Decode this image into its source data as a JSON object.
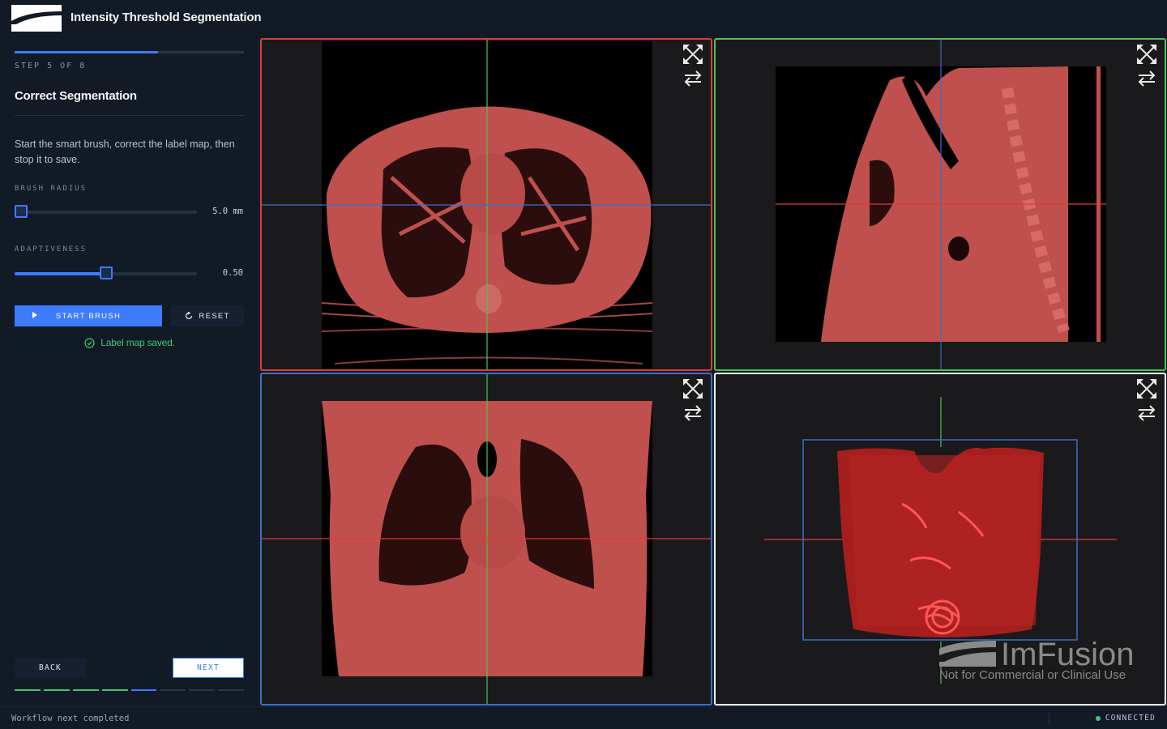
{
  "header": {
    "title": "Intensity Threshold Segmentation",
    "logo": "imfusion-logo"
  },
  "workflow": {
    "step_label": "STEP 5 OF 8",
    "progress": 0.625,
    "step_title": "Correct Segmentation",
    "instructions": "Start the smart brush, correct the label map, then stop it to save.",
    "params": {
      "brush_radius": {
        "label": "BRUSH RADIUS",
        "value": "5.0 mm",
        "fraction": 0.03
      },
      "adaptiveness": {
        "label": "ADAPTIVENESS",
        "value": "0.50",
        "fraction": 0.5
      }
    },
    "start_brush_label": "START BRUSH",
    "reset_label": "RESET",
    "status_message": "Label map saved.",
    "back_label": "BACK",
    "next_label": "NEXT",
    "steps": {
      "total": 8,
      "completed": 4,
      "current": 5
    }
  },
  "statusbar": {
    "message": "Workflow next completed",
    "connection": "CONNECTED"
  },
  "viewports": [
    {
      "id": "axial",
      "border_color": "#e03a3a",
      "icons": [
        "maximize-icon",
        "swap-icon"
      ]
    },
    {
      "id": "sagittal",
      "border_color": "#4cc34c",
      "icons": [
        "maximize-icon",
        "swap-icon"
      ]
    },
    {
      "id": "coronal",
      "border_color": "#3a6fc9",
      "icons": [
        "maximize-icon",
        "swap-icon"
      ]
    },
    {
      "id": "3d",
      "border_color": "#ffffff",
      "icons": [
        "maximize-icon",
        "swap-icon"
      ]
    }
  ],
  "watermark": {
    "brand": "ImFusion",
    "subtitle": "Not for Commercial or Clinical Use"
  },
  "colors": {
    "accent": "#3d7bff",
    "success": "#3ec77a",
    "label_overlay": "#c0504d"
  }
}
